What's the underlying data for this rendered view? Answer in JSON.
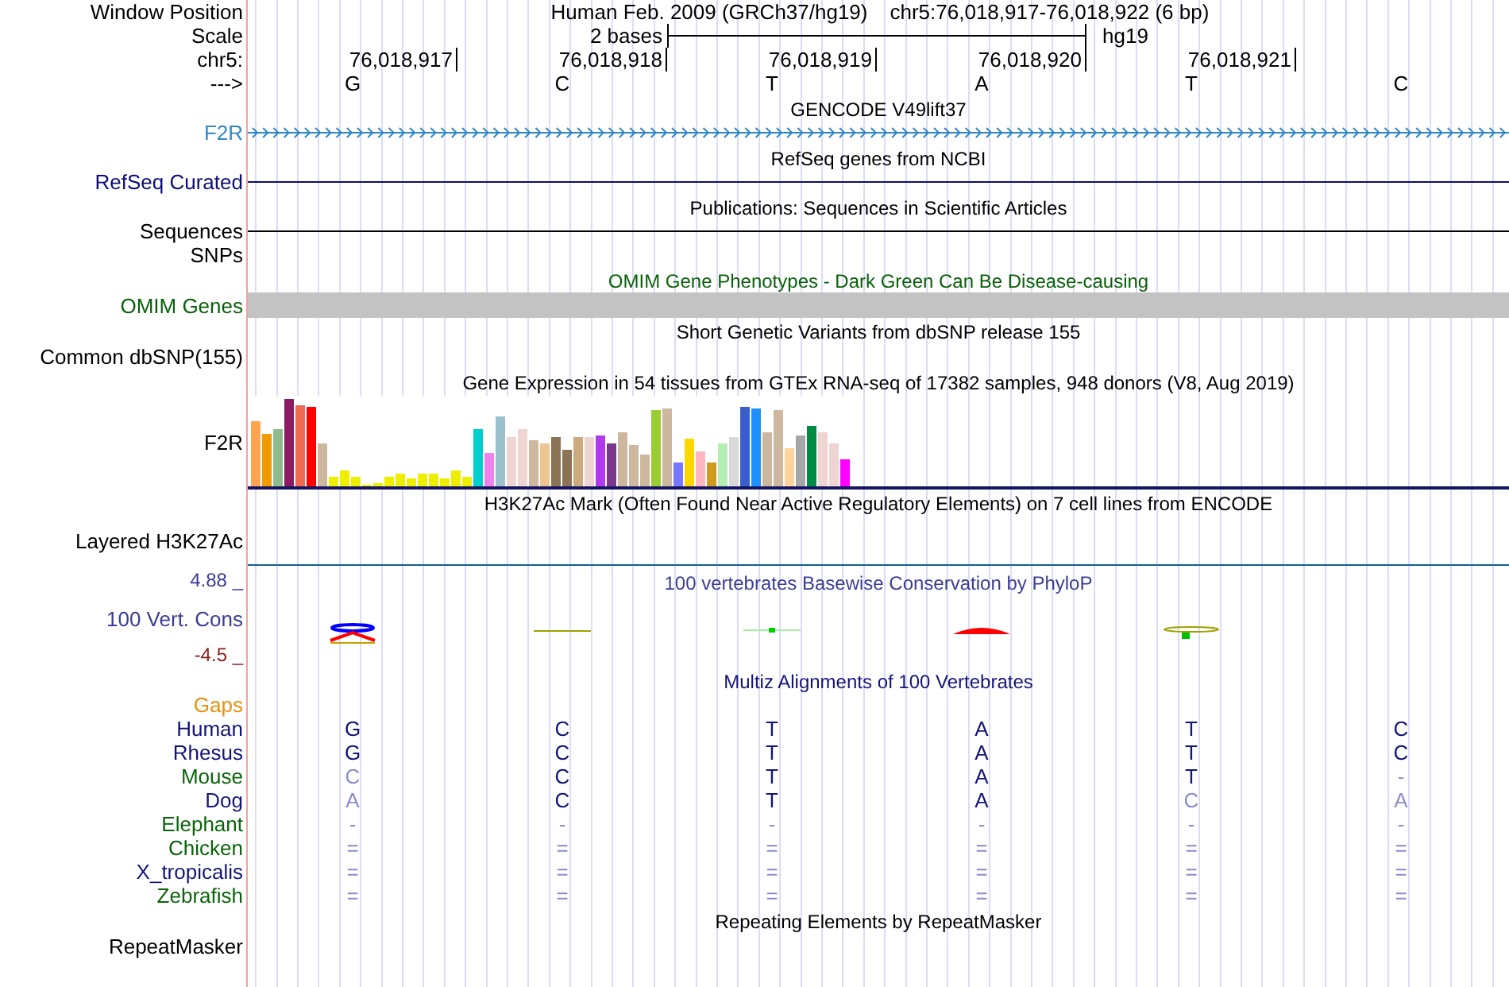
{
  "position": {
    "label": "Window Position",
    "assembly": "Human Feb. 2009 (GRCh37/hg19)",
    "range": "chr5:76,018,917-76,018,922 (6 bp)"
  },
  "scale": {
    "label": "Scale",
    "span": "2 bases",
    "assembly": "hg19"
  },
  "chromosome": {
    "label": "chr5:",
    "positions": [
      "76,018,917",
      "76,018,918",
      "76,018,919",
      "76,018,920",
      "76,018,921"
    ]
  },
  "strand": {
    "label": "--->",
    "bases": [
      "G",
      "C",
      "T",
      "A",
      "T",
      "C"
    ]
  },
  "tracks": [
    {
      "kind": "arrows",
      "title": {
        "text": "GENCODE V49lift37",
        "color": "#000000"
      },
      "label_lines": [
        "F2R"
      ],
      "color": "#2f86c8"
    },
    {
      "kind": "line",
      "title": {
        "text": "RefSeq genes from NCBI",
        "color": "#000000"
      },
      "label_lines": [
        "RefSeq Curated"
      ],
      "color": "#0c0c78"
    },
    {
      "kind": "line",
      "title": {
        "text": "Publications: Sequences in Scientific Articles",
        "color": "#000000"
      },
      "label_lines": [
        "Sequences",
        "SNPs"
      ],
      "color": "#000000"
    },
    {
      "kind": "bar",
      "title": {
        "text": "OMIM Gene Phenotypes - Dark Green Can Be Disease-causing",
        "color": "#0a600a"
      },
      "label_lines": [
        "OMIM Genes"
      ],
      "color": "#0a600a"
    },
    {
      "kind": "empty",
      "title": {
        "text": "Short Genetic Variants from dbSNP release 155",
        "color": "#000000"
      },
      "label_lines": [
        "Common dbSNP(155)"
      ],
      "color": "#000000"
    },
    {
      "kind": "expression",
      "title": {
        "text": "Gene Expression in 54 tissues from GTEx RNA-seq of 17382 samples, 948 donors (V8, Aug 2019)",
        "color": "#000000"
      },
      "label_lines": [
        "F2R"
      ],
      "color": "#000000"
    },
    {
      "kind": "layered",
      "title": {
        "text": "H3K27Ac Mark (Often Found Near Active Regulatory Elements) on 7 cell lines from ENCODE",
        "color": "#000000"
      },
      "label_lines": [
        "Layered H3K27Ac"
      ],
      "color": "#000000"
    },
    {
      "kind": "conservation",
      "title": {
        "text": "100 vertebrates Basewise Conservation by PhyloP",
        "color": "#3c3c96"
      },
      "label_lines": [
        "100 Vert. Cons"
      ],
      "color": "#3c3c96",
      "max": "4.88 _",
      "min": "-4.5 _"
    },
    {
      "kind": "alignment",
      "title": {
        "text": "Multiz Alignments of 100 Vertebrates",
        "color": "#141478"
      },
      "rows": [
        {
          "name": "Gaps",
          "color": "#e8900a",
          "bases": []
        },
        {
          "name": "Human",
          "color": "#141478",
          "bases": [
            {
              "text": "G",
              "mismatch": false
            },
            {
              "text": "C",
              "mismatch": false
            },
            {
              "text": "T",
              "mismatch": false
            },
            {
              "text": "A",
              "mismatch": false
            },
            {
              "text": "T",
              "mismatch": false
            },
            {
              "text": "C",
              "mismatch": false
            }
          ]
        },
        {
          "name": "Rhesus",
          "color": "#141478",
          "bases": [
            {
              "text": "G",
              "mismatch": false
            },
            {
              "text": "C",
              "mismatch": false
            },
            {
              "text": "T",
              "mismatch": false
            },
            {
              "text": "A",
              "mismatch": false
            },
            {
              "text": "T",
              "mismatch": false
            },
            {
              "text": "C",
              "mismatch": false
            }
          ]
        },
        {
          "name": "Mouse",
          "color": "#0a640a",
          "bases": [
            {
              "text": "C",
              "mismatch": true
            },
            {
              "text": "C",
              "mismatch": false
            },
            {
              "text": "T",
              "mismatch": false
            },
            {
              "text": "A",
              "mismatch": false
            },
            {
              "text": "T",
              "mismatch": false
            },
            {
              "text": "-",
              "mismatch": true
            }
          ]
        },
        {
          "name": "Dog",
          "color": "#141478",
          "bases": [
            {
              "text": "A",
              "mismatch": true
            },
            {
              "text": "C",
              "mismatch": false
            },
            {
              "text": "T",
              "mismatch": false
            },
            {
              "text": "A",
              "mismatch": false
            },
            {
              "text": "C",
              "mismatch": true
            },
            {
              "text": "A",
              "mismatch": true
            }
          ]
        },
        {
          "name": "Elephant",
          "color": "#0a640a",
          "bases": [
            {
              "text": "-",
              "mismatch": true
            },
            {
              "text": "-",
              "mismatch": true
            },
            {
              "text": "-",
              "mismatch": true
            },
            {
              "text": "-",
              "mismatch": true
            },
            {
              "text": "-",
              "mismatch": true
            },
            {
              "text": "-",
              "mismatch": true
            }
          ]
        },
        {
          "name": "Chicken",
          "color": "#0a640a",
          "bases": [
            {
              "text": "=",
              "mismatch": true
            },
            {
              "text": "=",
              "mismatch": true
            },
            {
              "text": "=",
              "mismatch": true
            },
            {
              "text": "=",
              "mismatch": true
            },
            {
              "text": "=",
              "mismatch": true
            },
            {
              "text": "=",
              "mismatch": true
            }
          ]
        },
        {
          "name": "X_tropicalis",
          "color": "#141478",
          "bases": [
            {
              "text": "=",
              "mismatch": true
            },
            {
              "text": "=",
              "mismatch": true
            },
            {
              "text": "=",
              "mismatch": true
            },
            {
              "text": "=",
              "mismatch": true
            },
            {
              "text": "=",
              "mismatch": true
            },
            {
              "text": "=",
              "mismatch": true
            }
          ]
        },
        {
          "name": "Zebrafish",
          "color": "#0a640a",
          "bases": [
            {
              "text": "=",
              "mismatch": true
            },
            {
              "text": "=",
              "mismatch": true
            },
            {
              "text": "=",
              "mismatch": true
            },
            {
              "text": "=",
              "mismatch": true
            },
            {
              "text": "=",
              "mismatch": true
            },
            {
              "text": "=",
              "mismatch": true
            }
          ]
        }
      ]
    },
    {
      "kind": "empty",
      "title": {
        "text": "Repeating Elements by RepeatMasker",
        "color": "#000000"
      },
      "label_lines": [
        "RepeatMasker"
      ],
      "color": "#000000"
    }
  ]
}
